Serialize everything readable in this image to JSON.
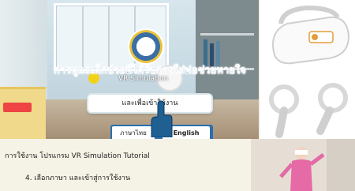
{
  "vr": {
    "title": "การดูแลเด็กป่วยที่ได้รับการใส่ท่อช่วยหายใจ",
    "subtitle": "VR Simulation",
    "enter_button": "และเพื่อเข้าใช้งาน",
    "language_buttons": [
      "ภาษาไทย",
      "English"
    ]
  },
  "caption": {
    "line1": "การใช้งาน โปรแกรม VR Simulation Tutorial",
    "line2": "4. เลือกภาษา และเข้าสู่การใช้งาน"
  },
  "colors": {
    "accent_blue": "#2b6fb0",
    "logo_gold": "#e9c23a"
  },
  "icons": {
    "headset": "vr-headset-icon",
    "controllers": "vr-controllers-icon",
    "hand": "hand-pointer-icon",
    "logo": "university-logo"
  }
}
